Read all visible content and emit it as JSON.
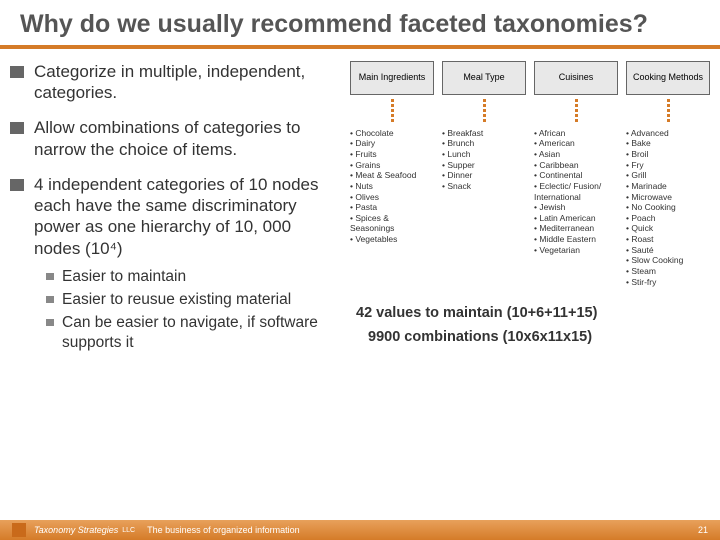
{
  "title": "Why do we usually recommend faceted taxonomies?",
  "bullets": [
    {
      "text": "Categorize in multiple, independent, categories."
    },
    {
      "text": "Allow combinations of categories to narrow the choice of items."
    },
    {
      "text": "4 independent categories of 10 nodes each have the same discriminatory power as one hierarchy of 10, 000 nodes (10⁴)"
    }
  ],
  "subbullets": [
    "Easier to maintain",
    "Easier to reusue existing material",
    "Can be easier to navigate, if software supports it"
  ],
  "facets": [
    {
      "header": "Main Ingredients",
      "items": [
        "Chocolate",
        "Dairy",
        "Fruits",
        "Grains",
        "Meat & Seafood",
        "Nuts",
        "Olives",
        "Pasta",
        "Spices & Seasonings",
        "Vegetables"
      ]
    },
    {
      "header": "Meal Type",
      "items": [
        "Breakfast",
        "Brunch",
        "Lunch",
        "Supper",
        "Dinner",
        "Snack"
      ]
    },
    {
      "header": "Cuisines",
      "items": [
        "African",
        "American",
        "Asian",
        "Caribbean",
        "Continental",
        "Eclectic/ Fusion/ International",
        "Jewish",
        "Latin American",
        "Mediterranean",
        "Middle Eastern",
        "Vegetarian"
      ]
    },
    {
      "header": "Cooking Methods",
      "items": [
        "Advanced",
        "Bake",
        "Broil",
        "Fry",
        "Grill",
        "Marinade",
        "Microwave",
        "No Cooking",
        "Poach",
        "Quick",
        "Roast",
        "Sauté",
        "Slow Cooking",
        "Steam",
        "Stir-fry"
      ]
    }
  ],
  "summary1": "42 values to maintain (10+6+11+15)",
  "summary2": "9900 combinations (10x6x11x15)",
  "footer": {
    "brand1": "Taxonomy",
    "brand2": "Strategies",
    "llc": "LLC",
    "tagline": "The business of organized information",
    "page": "21"
  }
}
